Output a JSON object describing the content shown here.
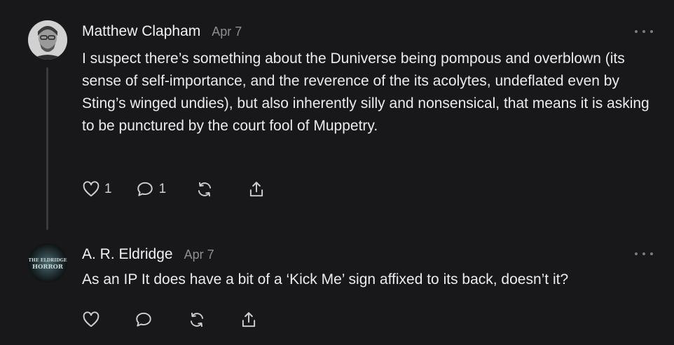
{
  "comments": [
    {
      "author": "Matthew Clapham",
      "date": "Apr 7",
      "text": "I suspect there’s something about the Duniverse being pompous and overblown (its sense of self-importance, and the reverence of the its acolytes, undeflated even by Sting’s winged undies), but also inherently silly and nonsensical, that means it is asking to be punctured by the court fool of Muppetry.",
      "likes": "1",
      "replies": "1",
      "icons": [
        "heart-icon",
        "comment-icon",
        "restack-icon",
        "share-icon"
      ]
    },
    {
      "author": "A. R. Eldridge",
      "date": "Apr 7",
      "avatar_text": [
        "THE ELDRIDGE",
        "HORROR"
      ],
      "text": "As an IP It does have a bit of a ‘Kick Me’ sign affixed to its back, doesn’t it?",
      "likes": "",
      "replies": "",
      "icons": [
        "heart-icon",
        "comment-icon",
        "restack-icon",
        "share-icon"
      ]
    }
  ],
  "colors": {
    "background": "#18181a",
    "text": "#ececec",
    "muted": "#8e8e92",
    "icon": "#cfcfd2"
  }
}
